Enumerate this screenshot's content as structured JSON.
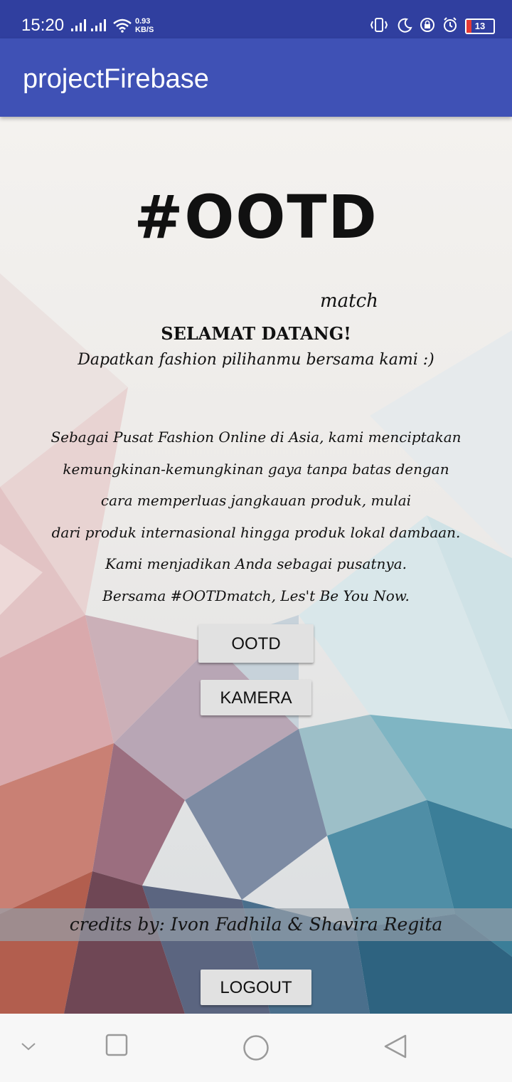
{
  "status_bar": {
    "time": "15:20",
    "net_speed_value": "0.93",
    "net_speed_unit": "KB/S",
    "battery_level": "13",
    "icons": [
      "signal-icon",
      "signal-icon",
      "wifi-icon",
      "vibrate-icon",
      "moon-icon",
      "lock-rotation-icon",
      "alarm-icon",
      "battery-icon"
    ]
  },
  "app_bar": {
    "title": "projectFirebase"
  },
  "logo": {
    "main": "#OOTD",
    "sub": "match"
  },
  "welcome": {
    "heading": "SELAMAT DATANG!",
    "tagline": "Dapatkan fashion pilihanmu bersama kami :)"
  },
  "about_lines": [
    "Sebagai Pusat Fashion Online di Asia, kami menciptakan",
    "kemungkinan-kemungkinan gaya tanpa batas dengan",
    "cara memperluas jangkauan produk, mulai",
    "dari produk internasional hingga produk lokal dambaan.",
    "Kami menjadikan Anda sebagai pusatnya.",
    "Bersama #OOTDmatch, Les't Be You Now."
  ],
  "buttons": {
    "ootd": "OOTD",
    "kamera": "KAMERA",
    "logout": "LOGOUT"
  },
  "credits": "credits by: Ivon Fadhila & Shavira Regita",
  "nav_bar": {
    "icons": [
      "chevron-down-icon",
      "recents-icon",
      "home-icon",
      "back-icon"
    ]
  },
  "colors": {
    "status_bar": "#303f9f",
    "app_bar": "#3f51b5",
    "button": "#e1e1e1",
    "battery_low": "#e53935"
  }
}
